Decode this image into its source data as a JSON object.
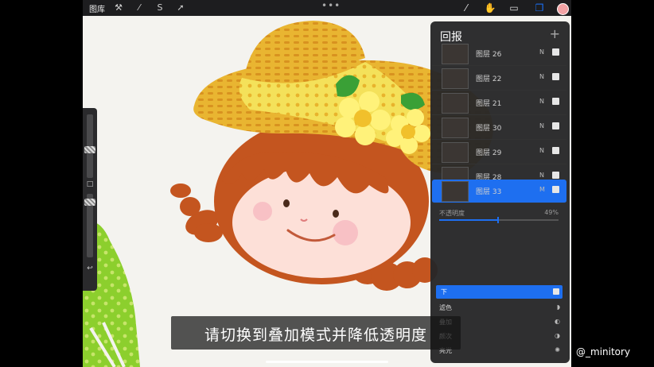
{
  "topbar": {
    "gallery_label": "图库",
    "tools": [
      {
        "name": "wrench-icon",
        "glyph": "⚒"
      },
      {
        "name": "magic-wand-icon",
        "glyph": "⁄"
      },
      {
        "name": "selection-icon",
        "glyph": "S"
      },
      {
        "name": "transform-icon",
        "glyph": "➚"
      }
    ],
    "more_dots": "•••",
    "right_tools": [
      {
        "name": "brush-icon",
        "glyph": "⁄"
      },
      {
        "name": "smudge-icon",
        "glyph": "✋"
      },
      {
        "name": "eraser-icon",
        "glyph": "▭"
      },
      {
        "name": "layers-icon",
        "glyph": "❐"
      }
    ],
    "color_swatch": "#f3a3a5"
  },
  "sidebar": {
    "undo_glyph": "↩",
    "modify_glyph": "□"
  },
  "layers_panel": {
    "title": "回报",
    "add_glyph": "+",
    "layers": [
      {
        "name": "图层 26",
        "mode": "N",
        "visible": true
      },
      {
        "name": "图层 22",
        "mode": "N",
        "visible": true
      },
      {
        "name": "图层 21",
        "mode": "N",
        "visible": true
      },
      {
        "name": "图层 30",
        "mode": "N",
        "visible": true
      },
      {
        "name": "图层 29",
        "mode": "N",
        "visible": true
      },
      {
        "name": "图层 28",
        "mode": "N",
        "visible": true
      },
      {
        "name": "图层 33",
        "mode": "M",
        "visible": true,
        "active": true
      }
    ],
    "opacity_label": "不透明度",
    "opacity_value": "49%",
    "opacity_fraction": 0.49,
    "blend_selected": "下",
    "blend_options": [
      {
        "label": "滤色",
        "icon": "◗"
      },
      {
        "label": "叠加",
        "icon": "◐"
      },
      {
        "label": "颜次",
        "icon": "◑"
      },
      {
        "label": "亮光",
        "icon": "✺"
      }
    ]
  },
  "subtitle": "请切换到叠加模式并降低透明度",
  "watermark": "@_minitory",
  "colors": {
    "accent": "#1e6ff0",
    "hat": "#e9b531",
    "hair": "#c4551f",
    "face": "#fde0d8",
    "leaf": "#9bd13a"
  }
}
